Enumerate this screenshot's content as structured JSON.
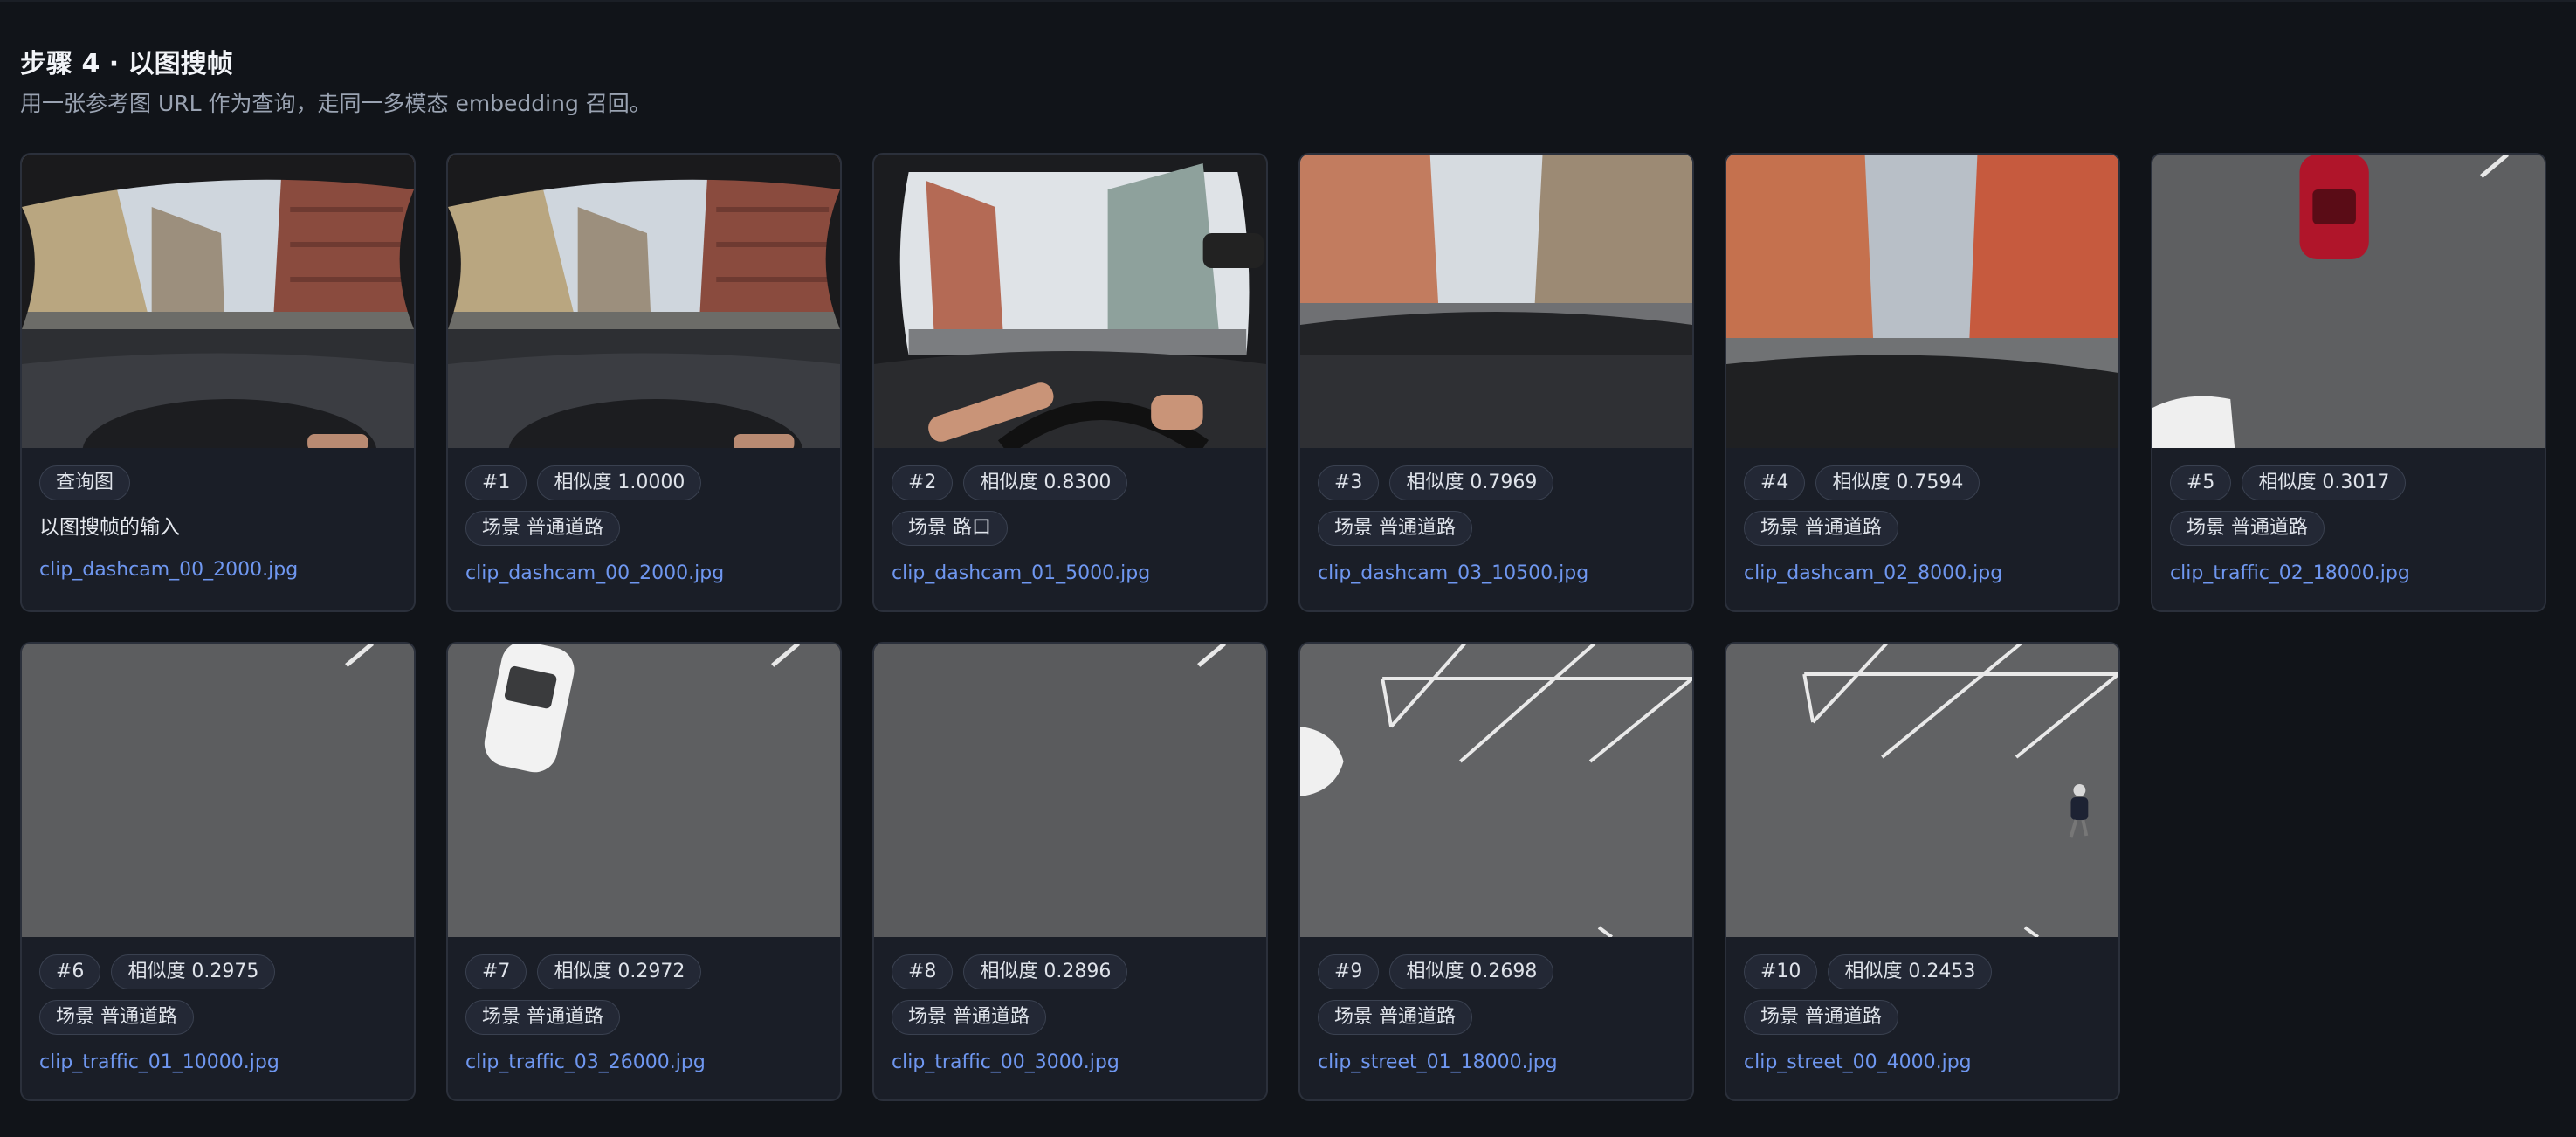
{
  "header": {
    "title": "步骤 4 · 以图搜帧",
    "subtitle": "用一张参考图 URL 作为查询，走同一多模态 embedding 召回。"
  },
  "cards": [
    {
      "tags": [
        "查询图"
      ],
      "desc": "以图搜帧的输入",
      "file": "clip_dashcam_00_2000.jpg"
    },
    {
      "tags": [
        "#1",
        "相似度 1.0000",
        "场景 普通道路"
      ],
      "file": "clip_dashcam_00_2000.jpg"
    },
    {
      "tags": [
        "#2",
        "相似度 0.8300",
        "场景 路口"
      ],
      "file": "clip_dashcam_01_5000.jpg"
    },
    {
      "tags": [
        "#3",
        "相似度 0.7969",
        "场景 普通道路"
      ],
      "file": "clip_dashcam_03_10500.jpg"
    },
    {
      "tags": [
        "#4",
        "相似度 0.7594",
        "场景 普通道路"
      ],
      "file": "clip_dashcam_02_8000.jpg"
    },
    {
      "tags": [
        "#5",
        "相似度 0.3017",
        "场景 普通道路"
      ],
      "file": "clip_traffic_02_18000.jpg"
    },
    {
      "tags": [
        "#6",
        "相似度 0.2975",
        "场景 普通道路"
      ],
      "file": "clip_traffic_01_10000.jpg"
    },
    {
      "tags": [
        "#7",
        "相似度 0.2972",
        "场景 普通道路"
      ],
      "file": "clip_traffic_03_26000.jpg"
    },
    {
      "tags": [
        "#8",
        "相似度 0.2896",
        "场景 普通道路"
      ],
      "file": "clip_traffic_00_3000.jpg"
    },
    {
      "tags": [
        "#9",
        "相似度 0.2698",
        "场景 普通道路"
      ],
      "file": "clip_street_01_18000.jpg"
    },
    {
      "tags": [
        "#10",
        "相似度 0.2453",
        "场景 普通道路"
      ],
      "file": "clip_street_00_4000.jpg"
    }
  ],
  "colors": {
    "background": "#111419",
    "card": "#1a1e27",
    "link": "#6f97f0",
    "tag_bg": "#232835"
  }
}
